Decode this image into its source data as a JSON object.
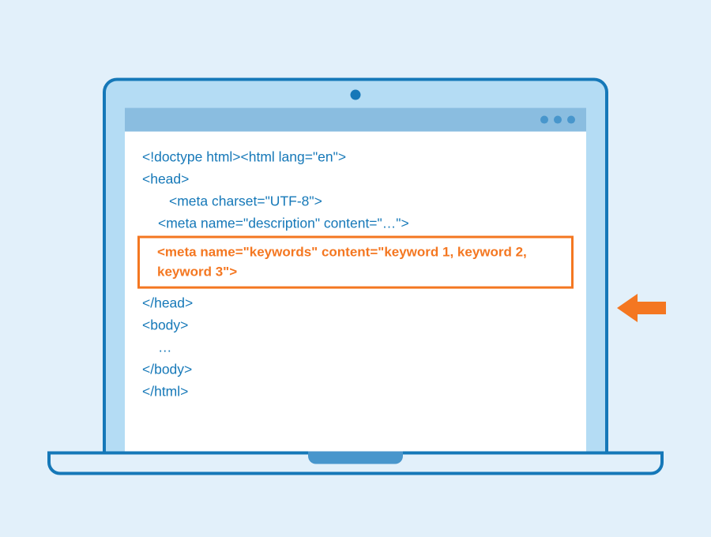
{
  "colors": {
    "background": "#e2f0fa",
    "laptop_outline": "#1578b8",
    "laptop_fill": "#b4dcf4",
    "titlebar": "#8abde0",
    "dot": "#4896cc",
    "code_text": "#1578b8",
    "highlight": "#f47721"
  },
  "code": {
    "line1": "<!doctype html><html lang=\"en\">",
    "line2": "<head>",
    "line3": "<meta charset=\"UTF-8\">",
    "line4": "<meta name=\"description\" content=\"…\">",
    "highlight": "<meta name=\"keywords\" content=\"keyword 1, keyword 2, keyword 3\">",
    "line5": "</head>",
    "line6": "<body>",
    "line7": "…",
    "line8": "</body>",
    "line9": "</html>"
  }
}
